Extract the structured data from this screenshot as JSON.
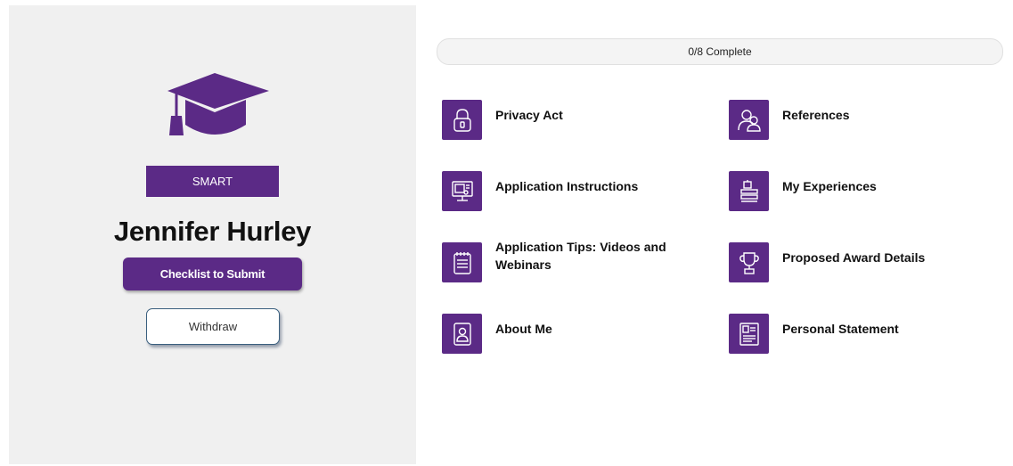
{
  "profile": {
    "program": "SMART",
    "name": "Jennifer Hurley",
    "checklist_button": "Checklist to Submit",
    "withdraw_button": "Withdraw"
  },
  "progress": {
    "label": "0/8 Complete",
    "completed": 0,
    "total": 8
  },
  "tasks": [
    {
      "label": "Privacy Act",
      "icon": "lock-icon"
    },
    {
      "label": "References",
      "icon": "people-icon"
    },
    {
      "label": "Application Instructions",
      "icon": "monitor-icon"
    },
    {
      "label": "My Experiences",
      "icon": "experience-icon"
    },
    {
      "label": "Application Tips: Videos and Webinars",
      "icon": "notepad-icon"
    },
    {
      "label": "Proposed Award Details",
      "icon": "trophy-icon"
    },
    {
      "label": "About Me",
      "icon": "profile-frame-icon"
    },
    {
      "label": "Personal Statement",
      "icon": "document-icon"
    }
  ],
  "colors": {
    "accent": "#5b2a86",
    "panel_background": "#f0f0f0"
  }
}
